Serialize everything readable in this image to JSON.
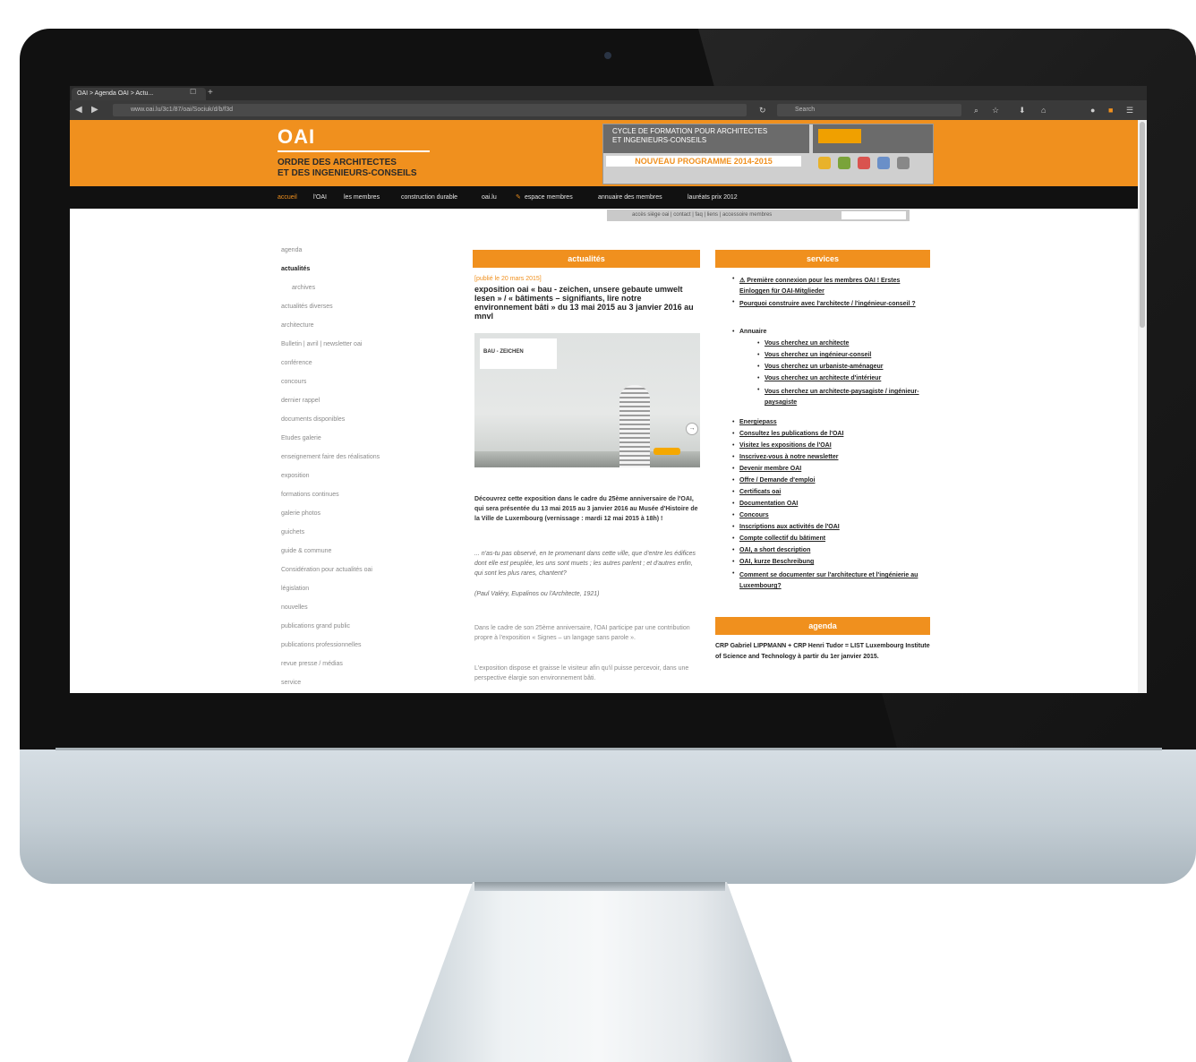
{
  "browser": {
    "tab_title": "OAI > Agenda OAI > Actu...",
    "tab_close": "☐",
    "new_tab": "+",
    "url": "www.oai.lu/3c1/87/oai/Sociuk/d/b/f3d",
    "search_placeholder": "Search"
  },
  "site": {
    "logo": "OAI",
    "org_line1": "ORDRE DES ARCHITECTES",
    "org_line2": "ET DES INGENIEURS-CONSEILS",
    "banner_line1": "CYCLE DE FORMATION POUR ARCHITECTES",
    "banner_line2": "ET INGENIEURS-CONSEILS",
    "banner_program": "NOUVEAU PROGRAMME 2014-2015",
    "main_nav": [
      "accueil",
      "l'OAI",
      "les membres",
      "construction durable",
      "oai.lu",
      "espace membres",
      "annuaire des membres",
      "lauréats prix 2012"
    ],
    "sub_nav": "accès siège oai | contact | faq | liens | accessoire membres"
  },
  "left_nav": [
    "agenda",
    "actualités",
    "archives",
    "actualités diverses",
    "architecture",
    "Bulletin | avril | newsletter oai",
    "conférence",
    "concours",
    "dernier rappel",
    "documents disponibles",
    "Etudes galerie",
    "enseignement faire des réalisations",
    "exposition",
    "formations continues",
    "galerie photos",
    "guichets",
    "guide & commune",
    "Considération pour actualités oai",
    "législation",
    "nouvelles",
    "publications grand public",
    "publications professionnelles",
    "revue presse / médias",
    "service"
  ],
  "middle": {
    "header": "actualités",
    "date": "[publié le 20 mars 2015]",
    "title": "exposition oai « bau - zeichen, unsere gebaute umwelt lesen » / « bâtiments – signifiants, lire notre environnement bâti » du 13 mai 2015 au 3 janvier 2016 au mnvl",
    "image_label": "BAU - ZEICHEN",
    "para1": "Découvrez cette exposition dans le cadre du 25ème anniversaire de l'OAI, qui sera présentée du 13 mai 2015 au 3 janvier 2016 au Musée d'Histoire de la Ville de Luxembourg (vernissage : mardi 12 mai 2015 à 18h) !",
    "quote": "... n'as-tu pas observé, en te promenant dans cette ville, que d'entre les édifices dont elle est peuplée, les uns sont muets ; les autres parlent ; et d'autres enfin, qui sont les plus rares, chantent?",
    "quote_source": "(Paul Valéry, Eupalinos ou l'Architecte, 1921)",
    "para2": "Dans le cadre de son 25ème anniversaire, l'OAI participe par une contribution propre à l'exposition « Signes – un langage sans parole ».",
    "para3": "L'exposition dispose et graisse le visiteur afin qu'il puisse percevoir, dans une perspective élargie son environnement bâti."
  },
  "right": {
    "header": "services",
    "links_top": [
      "⚠ Première connexion pour les membres OAI ! Erstes Einloggen für OAI-Mitglieder",
      "Pourquoi construire avec l'architecte / l'ingénieur-conseil ?"
    ],
    "annuaire_label": "Annuaire",
    "annuaire_links": [
      "Vous cherchez un architecte",
      "Vous cherchez un ingénieur-conseil",
      "Vous cherchez un urbaniste-aménageur",
      "Vous cherchez un architecte d'intérieur",
      "Vous cherchez un architecte-paysagiste / ingénieur-paysagiste"
    ],
    "links_bottom": [
      "Energiepass",
      "Consultez les publications de l'OAI",
      "Visitez les expositions de l'OAI",
      "Inscrivez-vous à notre newsletter",
      "Devenir membre OAI",
      "Offre / Demande d'emploi",
      "Certificats oai",
      "Documentation OAI",
      "Concours",
      "Inscriptions aux activités de l'OAI",
      "Compte collectif du bâtiment",
      "OAI, a short description",
      "OAI, kurze Beschreibung",
      "Comment se documenter sur l'architecture et l'ingénierie au Luxembourg?"
    ],
    "agenda_header": "agenda",
    "agenda_text": "CRP Gabriel LIPPMANN + CRP Henri Tudor = LIST Luxembourg Institute of Science and Technology à partir du 1er janvier 2015."
  }
}
